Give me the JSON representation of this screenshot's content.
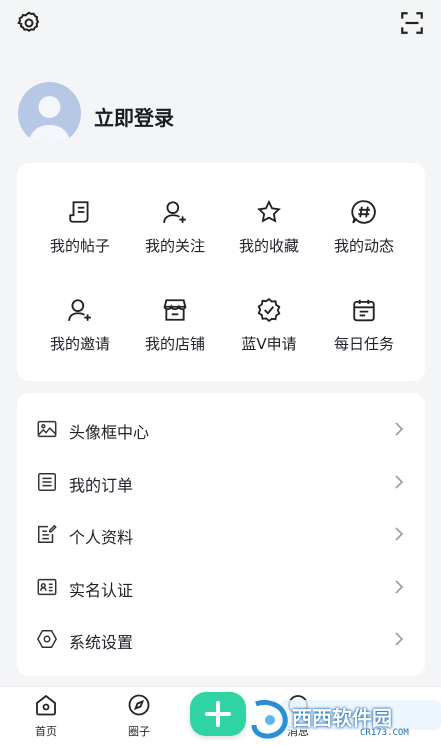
{
  "header": {
    "settings_icon": "gear-icon",
    "scan_icon": "scan-icon"
  },
  "profile": {
    "avatar_icon": "default-avatar",
    "login_label": "立即登录"
  },
  "shortcuts": [
    {
      "label": "我的帖子",
      "icon": "post-icon"
    },
    {
      "label": "我的关注",
      "icon": "follow-icon"
    },
    {
      "label": "我的收藏",
      "icon": "star-icon"
    },
    {
      "label": "我的动态",
      "icon": "hashtag-icon"
    },
    {
      "label": "我的邀请",
      "icon": "invite-icon"
    },
    {
      "label": "我的店铺",
      "icon": "store-icon"
    },
    {
      "label": "蓝V申请",
      "icon": "verified-badge-icon"
    },
    {
      "label": "每日任务",
      "icon": "calendar-icon"
    }
  ],
  "menu": [
    {
      "label": "头像框中心",
      "icon": "image-frame-icon"
    },
    {
      "label": "我的订单",
      "icon": "order-list-icon"
    },
    {
      "label": "个人资料",
      "icon": "edit-profile-icon"
    },
    {
      "label": "实名认证",
      "icon": "id-card-icon"
    },
    {
      "label": "系统设置",
      "icon": "hexagon-settings-icon"
    }
  ],
  "tabbar": {
    "tabs": [
      {
        "label": "首页",
        "icon": "home-icon"
      },
      {
        "label": "圈子",
        "icon": "compass-icon"
      },
      {
        "label": "消息",
        "icon": "message-icon"
      }
    ],
    "fab_icon": "plus-icon"
  },
  "watermark": {
    "text": "西西软件园",
    "url": "CR173.COM"
  },
  "colors": {
    "accent": "#30d3a4",
    "background": "#f4f5f7",
    "card": "#ffffff",
    "avatar": "#b7c8e6"
  }
}
